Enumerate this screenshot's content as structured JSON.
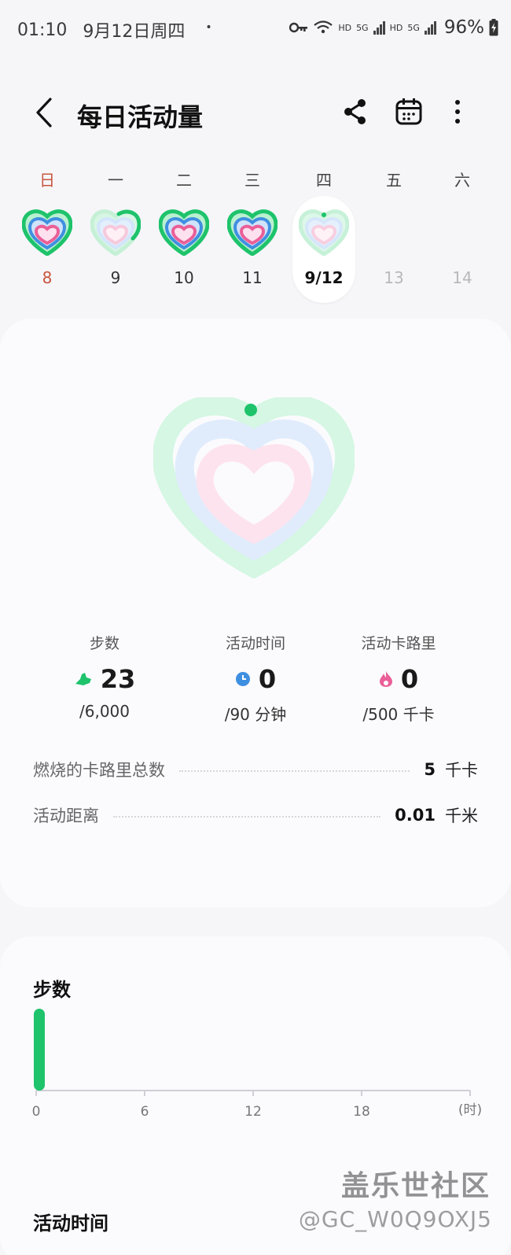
{
  "status_bar": {
    "time": "01:10",
    "date": "9月12日周四",
    "dot": "•",
    "hd1": "HD",
    "net1": "5G",
    "hd2": "HD",
    "net2": "5G",
    "battery": "96%"
  },
  "app_bar": {
    "title": "每日活动量",
    "icons": [
      "back-icon",
      "share-icon",
      "calendar-icon",
      "more-icon"
    ]
  },
  "week": {
    "days": [
      {
        "weekday": "日",
        "date": "8",
        "state": "past"
      },
      {
        "weekday": "一",
        "date": "9",
        "state": "past"
      },
      {
        "weekday": "二",
        "date": "10",
        "state": "past"
      },
      {
        "weekday": "三",
        "date": "11",
        "state": "past"
      },
      {
        "weekday": "四",
        "date": "9/12",
        "state": "selected"
      },
      {
        "weekday": "五",
        "date": "13",
        "state": "future"
      },
      {
        "weekday": "六",
        "date": "14",
        "state": "future"
      }
    ]
  },
  "colors": {
    "steps_green": "#1ec36b",
    "active_blue": "#3f8fe0",
    "calories_pink": "#ea5f98",
    "sunday_red": "#c8553d"
  },
  "metrics": [
    {
      "label": "步数",
      "value": "23",
      "goal": "/6,000",
      "icon": "shoe-icon"
    },
    {
      "label": "活动时间",
      "value": "0",
      "goal": "/90 分钟",
      "icon": "clock-icon"
    },
    {
      "label": "活动卡路里",
      "value": "0",
      "goal": "/500 千卡",
      "icon": "flame-icon"
    }
  ],
  "summary": [
    {
      "label": "燃烧的卡路里总数",
      "value": "5",
      "unit": "千卡"
    },
    {
      "label": "活动距离",
      "value": "0.01",
      "unit": "千米"
    }
  ],
  "steps_section": {
    "title": "步数",
    "unit_label": "(时)"
  },
  "chart_data": {
    "type": "bar",
    "title": "步数",
    "xlabel": "(时)",
    "ylabel": "",
    "x_ticks": [
      "0",
      "6",
      "12",
      "18"
    ],
    "x": [
      0
    ],
    "values": [
      23
    ],
    "xlim": [
      0,
      24
    ],
    "grid": false
  },
  "next_section": {
    "title": "活动时间"
  },
  "watermark": {
    "brand": "盖乐世社区",
    "user": "@GC_W0Q9OXJ5"
  }
}
